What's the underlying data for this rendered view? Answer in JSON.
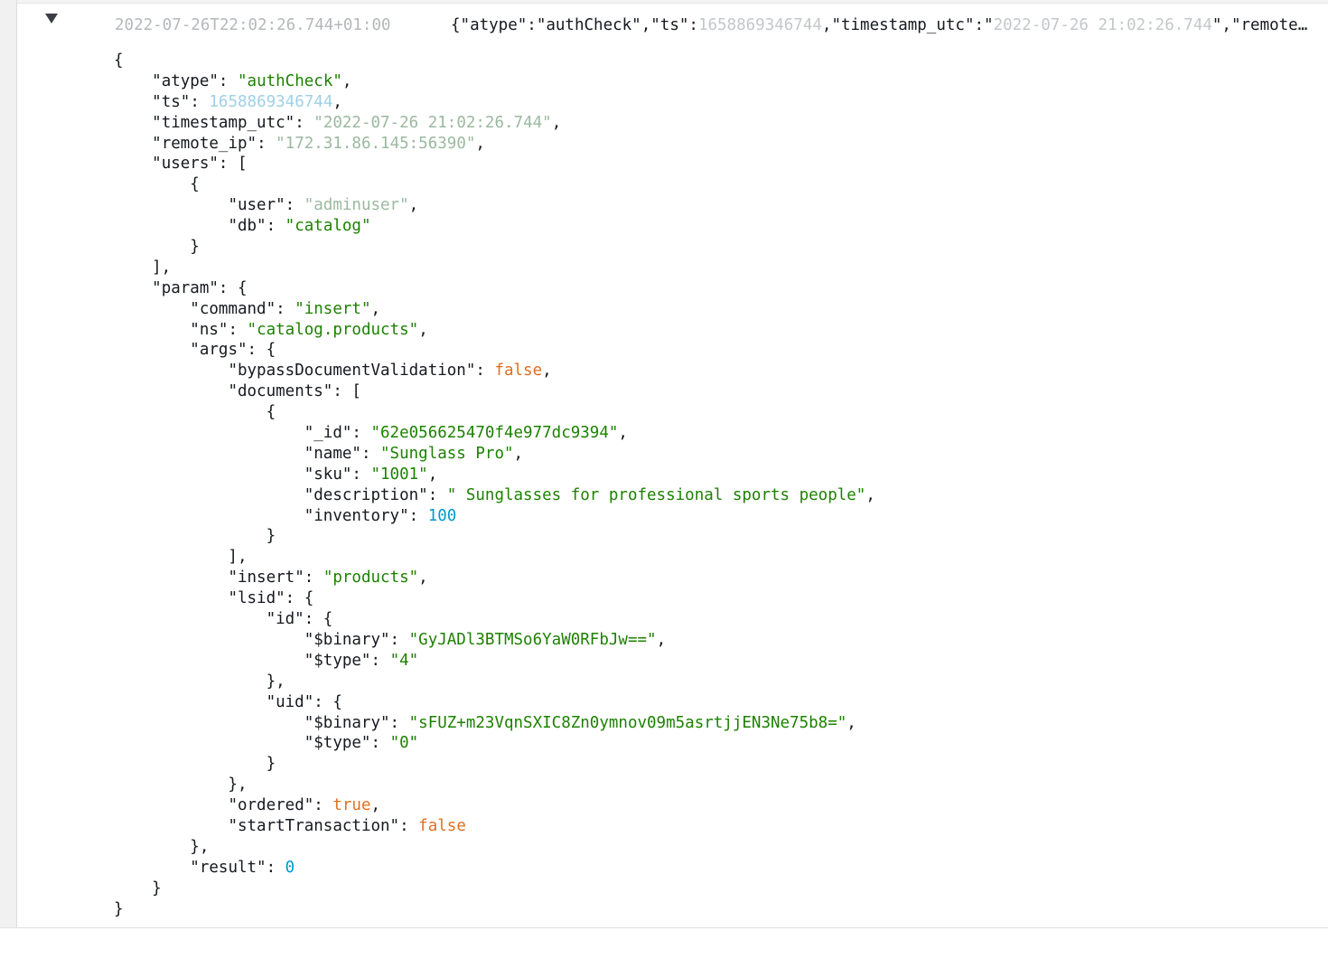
{
  "row": {
    "timestamp": "2022-07-26T22:02:26.744+01:00",
    "message_prefix": "{\"atype\":\"authCheck\",\"ts\":",
    "message_ts": "1658869346744",
    "message_mid": ",\"timestamp_utc\":\"",
    "message_tsutc": "2022-07-26 21:02:26.744",
    "message_suffix": "\",\"remote_i…"
  },
  "json": {
    "atype_key": "\"atype\"",
    "atype_val": "\"authCheck\"",
    "ts_key": "\"ts\"",
    "ts_val": "1658869346744",
    "timestamp_utc_key": "\"timestamp_utc\"",
    "timestamp_utc_val": "\"2022-07-26 21:02:26.744\"",
    "remote_ip_key": "\"remote_ip\"",
    "remote_ip_val": "\"172.31.86.145:56390\"",
    "users_key": "\"users\"",
    "user_key": "\"user\"",
    "user_val": "\"adminuser\"",
    "db_key": "\"db\"",
    "db_val": "\"catalog\"",
    "param_key": "\"param\"",
    "command_key": "\"command\"",
    "command_val": "\"insert\"",
    "ns_key": "\"ns\"",
    "ns_val": "\"catalog.products\"",
    "args_key": "\"args\"",
    "bypass_key": "\"bypassDocumentValidation\"",
    "bypass_val": "false",
    "documents_key": "\"documents\"",
    "id_key": "\"_id\"",
    "id_val": "\"62e056625470f4e977dc9394\"",
    "name_key": "\"name\"",
    "name_val": "\"Sunglass Pro\"",
    "sku_key": "\"sku\"",
    "sku_val": "\"1001\"",
    "description_key": "\"description\"",
    "description_val": "\" Sunglasses for professional sports people\"",
    "inventory_key": "\"inventory\"",
    "inventory_val": "100",
    "insert_key": "\"insert\"",
    "insert_val": "\"products\"",
    "lsid_key": "\"lsid\"",
    "lsid_id_key": "\"id\"",
    "binary_key": "\"$binary\"",
    "lsid_id_binary": "\"GyJADl3BTMSo6YaW0RFbJw==\"",
    "type_key": "\"$type\"",
    "lsid_id_type": "\"4\"",
    "uid_key": "\"uid\"",
    "uid_binary": "\"sFUZ+m23VqnSXIC8Zn0ymnov09m5asrtjjEN3Ne75b8=\"",
    "uid_type": "\"0\"",
    "ordered_key": "\"ordered\"",
    "ordered_val": "true",
    "start_key": "\"startTransaction\"",
    "start_val": "false",
    "result_key": "\"result\"",
    "result_val": "0"
  },
  "colors": {
    "string": "#1d8102",
    "number": "#0099cc",
    "boolean": "#e07020",
    "key": "#16191f"
  },
  "icons": {
    "toggle": "caret-down-icon"
  }
}
